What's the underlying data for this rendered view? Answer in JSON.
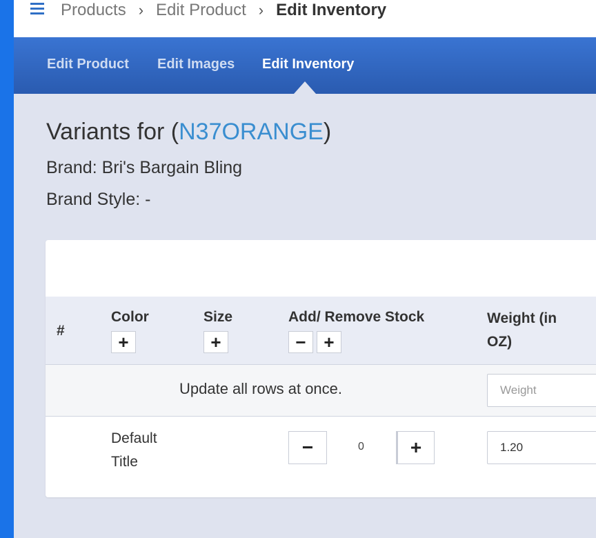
{
  "breadcrumb": {
    "items": [
      "Products",
      "Edit Product",
      "Edit Inventory"
    ],
    "separator": "›"
  },
  "tabs": [
    {
      "label": "Edit Product",
      "active": false
    },
    {
      "label": "Edit Images",
      "active": false
    },
    {
      "label": "Edit Inventory",
      "active": true
    }
  ],
  "heading": {
    "prefix": "Variants for (",
    "sku": "N37ORANGE",
    "suffix": ")"
  },
  "brand": "Brand: Bri's Bargain Bling",
  "brand_style": "Brand Style: -",
  "table": {
    "columns": {
      "number": "#",
      "color": "Color",
      "size": "Size",
      "stock": "Add/ Remove Stock",
      "weight_line1": "Weight (in",
      "weight_line2": "OZ)"
    },
    "bulk": {
      "text": "Update all rows at once.",
      "weight_placeholder": "Weight"
    },
    "rows": [
      {
        "title_line1": "Default",
        "title_line2": "Title",
        "stock_delta": "0",
        "weight": "1.20"
      }
    ]
  },
  "icons": {
    "menu": "hamburger-icon",
    "add": "plus-icon",
    "remove": "minus-icon"
  },
  "colors": {
    "accent": "#2a5bb0",
    "link": "#3a8ed0",
    "left_strip": "#1a73e8"
  }
}
